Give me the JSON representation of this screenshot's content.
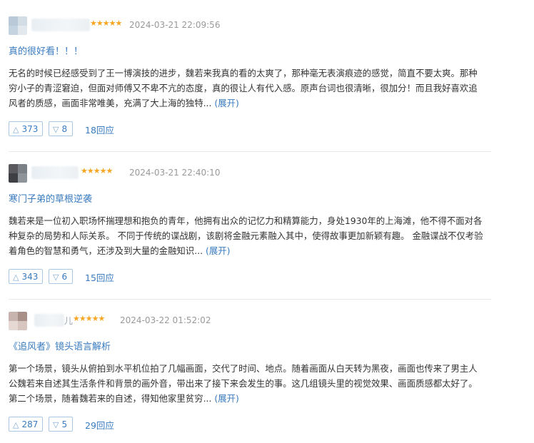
{
  "reviews": [
    {
      "user": "",
      "stars": "★★★★★",
      "time": "2024-03-21 22:09:56",
      "title": "真的很好看！！！",
      "content": "无名的时候已经感受到了王一博演技的进步，魏若来我真的看的太爽了，那种毫无表演痕迹的感觉，简直不要太爽。那种穷小子的青涩窘迫，但面对师傅又不卑不亢的态度，真的很让人有代入感。原声台词也很清晰，很加分！而且我好喜欢追风者的质感，画面非常唯美，充满了大上海的独特...",
      "expand": "(展开)",
      "up": "373",
      "down": "8",
      "replies": "18回应"
    },
    {
      "user": "",
      "stars": "★★★★★",
      "time": "2024-03-21 22:40:10",
      "title": "寒门子弟的草根逆袭",
      "content": "魏若来是一位初入职场怀揣理想和抱负的青年，他拥有出众的记忆力和精算能力，身处1930年的上海滩，他不得不面对各种复杂的局势和人际关系。 不同于传统的谍战剧，该剧将金融元素融入其中，使得故事更加新颖有趣。 金融谍战不仅考验着角色的智慧和勇气，还涉及到大量的金融知识...",
      "expand": "(展开)",
      "up": "343",
      "down": "6",
      "replies": "15回应"
    },
    {
      "user": "儿",
      "stars": "★★★★★",
      "time": "2024-03-22 01:52:02",
      "title": "《追风者》镜头语言解析",
      "content": "第一个场景，镜头从俯拍到水平机位拍了几幅画面，交代了时间、地点。随着画面从白天转为黑夜，画面也传来了男主人公魏若来自述其生活条件和背景的画外音，带出来了接下来会发生的事。这几组镜头里的视觉效果、画面质感都太好了。 第二个场景，随着魏若来的自述，得知他家里贫穷...",
      "expand": "(展开)",
      "up": "287",
      "down": "5",
      "replies": "29回应"
    }
  ],
  "icons": {
    "up": "thumb-up-icon",
    "down": "thumb-down-icon"
  },
  "colors": {
    "link": "#3a7bbf",
    "star": "#f5a623",
    "time": "#999999"
  }
}
